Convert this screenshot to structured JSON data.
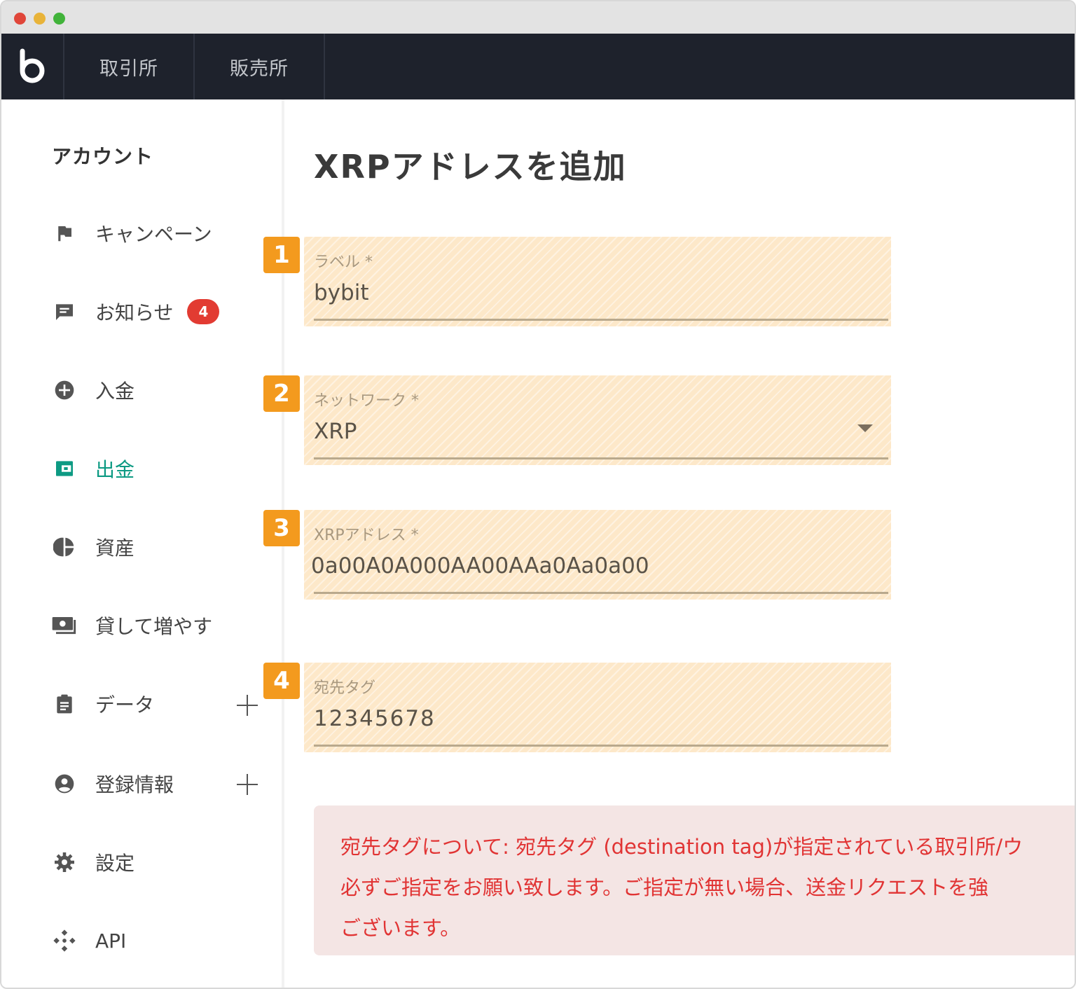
{
  "nav": {
    "logo_icon": "bitbank-logo-icon",
    "tabs": [
      {
        "label": "取引所"
      },
      {
        "label": "販売所"
      }
    ]
  },
  "sidebar": {
    "title": "アカウント",
    "items": [
      {
        "label": "キャンペーン",
        "icon": "flag-icon"
      },
      {
        "label": "お知らせ",
        "icon": "message-icon",
        "badge": "4"
      },
      {
        "label": "入金",
        "icon": "plus-circle-icon"
      },
      {
        "label": "出金",
        "icon": "wallet-icon",
        "active": true
      },
      {
        "label": "資産",
        "icon": "pie-chart-icon"
      },
      {
        "label": "貸して増やす",
        "icon": "cash-icon"
      },
      {
        "label": "データ",
        "icon": "clipboard-icon",
        "expandable": true
      },
      {
        "label": "登録情報",
        "icon": "account-circle-icon",
        "expandable": true
      },
      {
        "label": "設定",
        "icon": "gear-icon"
      },
      {
        "label": "API",
        "icon": "api-icon"
      }
    ]
  },
  "main": {
    "title": "XRPアドレスを追加",
    "fields": [
      {
        "marker": "1",
        "label": "ラベル *",
        "value": "bybit"
      },
      {
        "marker": "2",
        "label": "ネットワーク *",
        "value": "XRP"
      },
      {
        "marker": "3",
        "label": "XRPアドレス *",
        "value": "0a00A0A000AA00AAa0Aa0a00"
      },
      {
        "marker": "4",
        "label": "宛先タグ",
        "value": "12345678"
      }
    ],
    "notice": "宛先タグについて: 宛先タグ (destination tag)が指定されている取引所/ウ\n必ずご指定をお願い致します。ご指定が無い場合、送金リクエストを強\nございます。"
  },
  "colors": {
    "navbar": "#1e222c",
    "active": "#0d9a83",
    "badge": "#e23b32",
    "marker": "#f39a1e",
    "notice_text": "#e13434",
    "notice_bg": "#f4e5e4"
  }
}
